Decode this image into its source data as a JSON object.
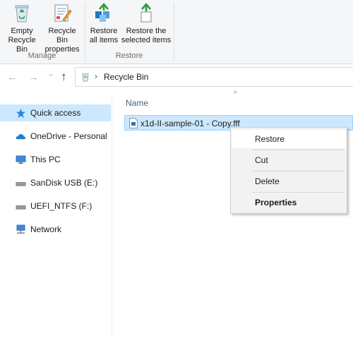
{
  "ribbon": {
    "manage": {
      "label": "Manage",
      "empty_bin": {
        "line1": "Empty",
        "line2": "Recycle Bin",
        "icon": "recycle-bin-icon"
      },
      "properties": {
        "line1": "Recycle Bin",
        "line2": "properties",
        "icon": "properties-icon"
      }
    },
    "restore": {
      "label": "Restore",
      "restore_all": {
        "line1": "Restore",
        "line2": "all items",
        "icon": "restore-all-icon"
      },
      "restore_selected": {
        "line1": "Restore the",
        "line2": "selected items",
        "icon": "restore-selected-icon"
      }
    }
  },
  "address_bar": {
    "back": "←",
    "forward": "→",
    "recent": "⌄",
    "up": "↑",
    "location_icon": "recycle-bin-icon",
    "chevron": "›",
    "path": "Recycle Bin"
  },
  "nav_pane": {
    "items": [
      {
        "label": "Quick access",
        "icon": "star-icon",
        "selected": true
      },
      {
        "label": "OneDrive - Personal",
        "icon": "cloud-icon",
        "selected": false
      },
      {
        "label": "This PC",
        "icon": "computer-icon",
        "selected": false
      },
      {
        "label": "SanDisk USB (E:)",
        "icon": "drive-icon",
        "selected": false
      },
      {
        "label": "UEFI_NTFS (F:)",
        "icon": "drive-icon",
        "selected": false
      },
      {
        "label": "Network",
        "icon": "network-icon",
        "selected": false
      }
    ]
  },
  "content": {
    "sort_indicator": "^",
    "column_name": "Name",
    "files": [
      {
        "name": "x1d-II-sample-01 - Copy.fff",
        "icon": "file-icon",
        "selected": true
      }
    ]
  },
  "context_menu": {
    "items": [
      "Restore",
      "Cut",
      "Delete",
      "Properties"
    ]
  },
  "colors": {
    "selection": "#cce8ff",
    "selection_border": "#99d1ff",
    "menu_bg": "#f2f2f2",
    "ribbon_bg": "#f5f6f7",
    "accent_blue": "#1979ca",
    "restore_green": "#2e9c3a"
  }
}
